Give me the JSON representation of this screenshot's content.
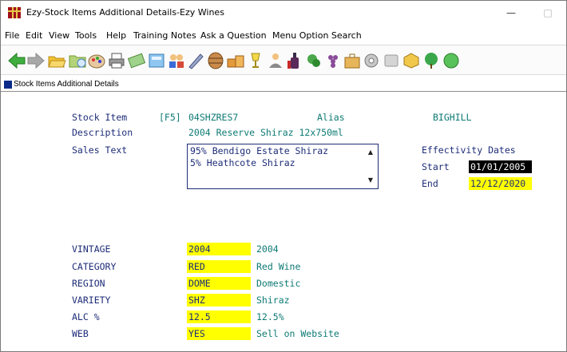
{
  "window": {
    "title": "Ezy-Stock Items Additional Details-Ezy Wines",
    "minimize_glyph": "—",
    "maximize_glyph": "□"
  },
  "menu": [
    "File",
    "Edit",
    "View",
    "Tools",
    "Help",
    "Training Notes",
    "Ask a Question",
    "Menu Option Search"
  ],
  "toolbar_icons": [
    "back-arrow-icon",
    "forward-arrow-icon",
    "folder-open-icon",
    "folder-icon",
    "palette-icon",
    "printer-icon",
    "note-icon",
    "calculator-icon",
    "people-icon",
    "pen-icon",
    "barrel-icon",
    "boxes-icon",
    "glass-icon",
    "person-icon",
    "wine-bottle-icon",
    "vine-icon",
    "grapes-icon",
    "briefcase-icon",
    "gear-icon",
    "card-icon",
    "cube-icon",
    "tree-icon",
    "money-icon"
  ],
  "subwindow": {
    "title": "Stock Items Additional Details"
  },
  "form": {
    "stock_item_label": "Stock Item",
    "f5_hint": "[F5]",
    "stock_item_value": "04SHZRES7",
    "alias_label": "Alias",
    "alias_value": "BIGHILL",
    "description_label": "Description",
    "description_value": "2004 Reserve Shiraz 12x750ml",
    "sales_text_label": "Sales Text",
    "sales_text_lines": [
      "95% Bendigo Estate Shiraz",
      "5% Heathcote Shiraz"
    ],
    "effectivity_label": "Effectivity Dates",
    "start_label": "Start",
    "start_value": "01/01/2005",
    "end_label": "End",
    "end_value": "12/12/2020"
  },
  "attributes": [
    {
      "label": "VINTAGE",
      "code": "2004",
      "desc": "2004"
    },
    {
      "label": "CATEGORY",
      "code": "RED",
      "desc": "Red Wine"
    },
    {
      "label": "REGION",
      "code": "DOME",
      "desc": "Domestic"
    },
    {
      "label": "VARIETY",
      "code": "SHZ",
      "desc": "Shiraz"
    },
    {
      "label": "ALC %",
      "code": "12.5",
      "desc": "12.5%"
    },
    {
      "label": "WEB",
      "code": "YES",
      "desc": "Sell on Website"
    }
  ],
  "colors": {
    "label": "#1e2d78",
    "value": "#0d7a74",
    "highlight": "#ffff00",
    "selected": "#000000"
  }
}
